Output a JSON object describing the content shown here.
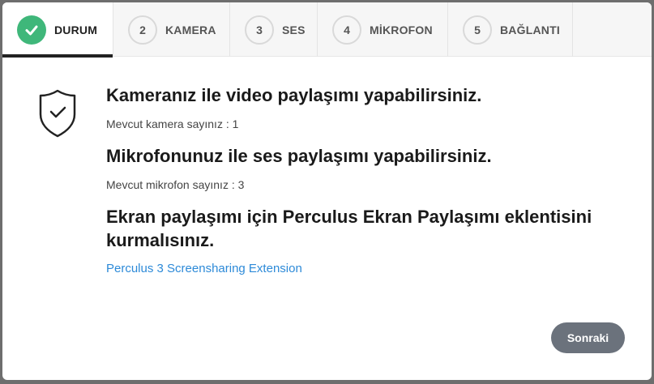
{
  "tabs": [
    {
      "number": "",
      "label": "DURUM",
      "state": "completed",
      "icon": "check-icon"
    },
    {
      "number": "2",
      "label": "KAMERA",
      "state": "pending"
    },
    {
      "number": "3",
      "label": "SES",
      "state": "pending"
    },
    {
      "number": "4",
      "label": "MİKROFON",
      "state": "pending"
    },
    {
      "number": "5",
      "label": "BAĞLANTI",
      "state": "pending"
    }
  ],
  "status": {
    "icon": "shield-check-icon",
    "camera_heading": "Kameranız ile video paylaşımı yapabilirsiniz.",
    "camera_count": "Mevcut kamera sayınız : 1",
    "mic_heading": "Mikrofonunuz ile ses paylaşımı yapabilirsiniz.",
    "mic_count": "Mevcut mikrofon sayınız : 3",
    "screen_heading": "Ekran paylaşımı için Perculus Ekran Paylaşımı eklentisini kurmalısınız.",
    "extension_link": "Perculus 3 Screensharing Extension"
  },
  "footer": {
    "next_label": "Sonraki"
  },
  "colors": {
    "success": "#3fb77a",
    "link": "#2d8ad8",
    "button": "#6b727c"
  }
}
